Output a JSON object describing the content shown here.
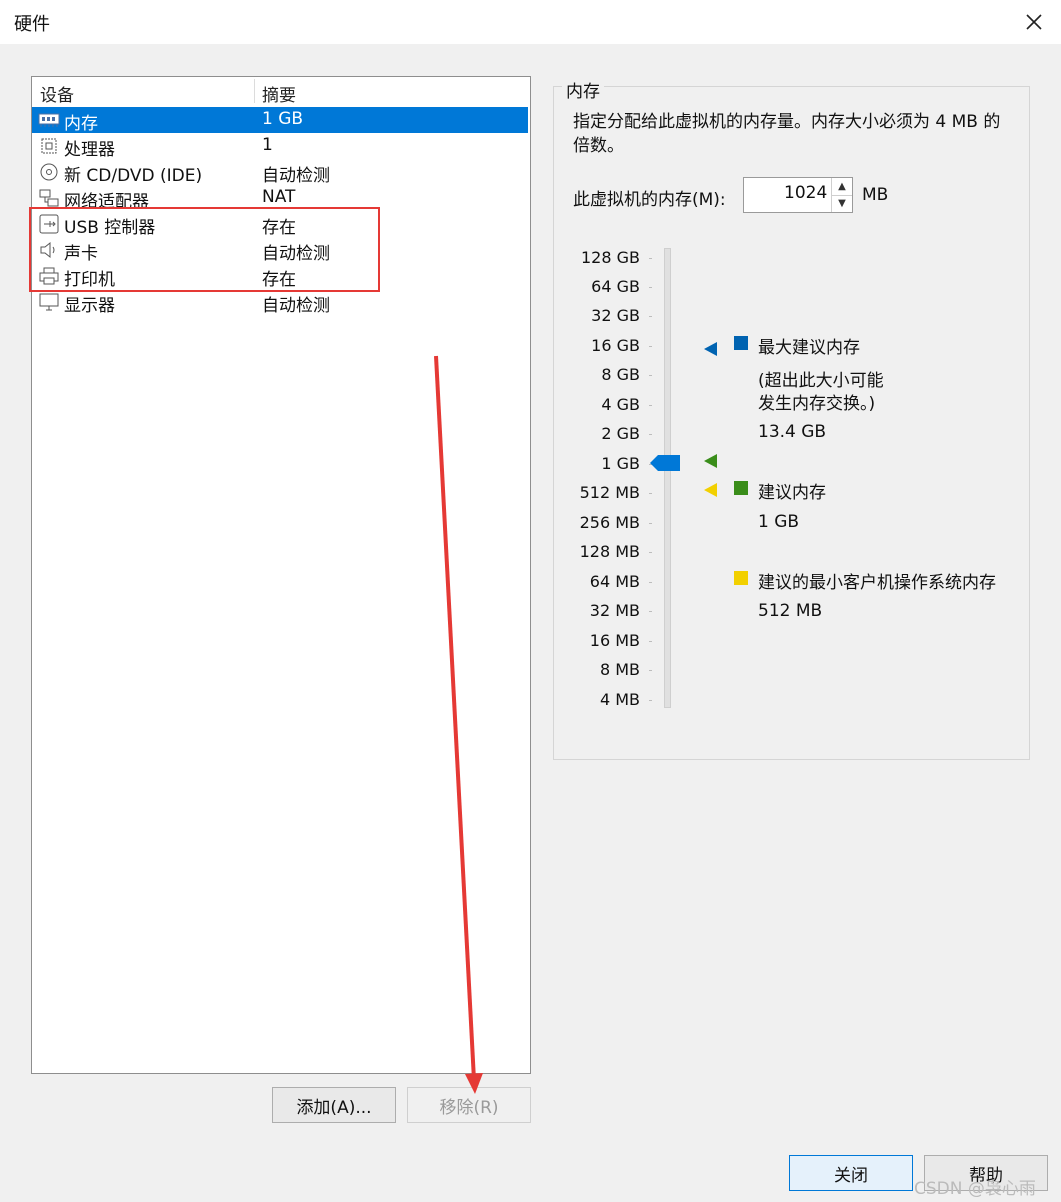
{
  "window": {
    "title": "硬件"
  },
  "device_list": {
    "columns": [
      "设备",
      "摘要"
    ],
    "items": [
      {
        "name": "内存",
        "summary": "1 GB",
        "icon": "memory-icon",
        "selected": true
      },
      {
        "name": "处理器",
        "summary": "1",
        "icon": "processor-icon",
        "selected": false
      },
      {
        "name": "新 CD/DVD (IDE)",
        "summary": "自动检测",
        "icon": "cd-dvd-icon",
        "selected": false
      },
      {
        "name": "网络适配器",
        "summary": "NAT",
        "icon": "network-adapter-icon",
        "selected": false
      },
      {
        "name": "USB 控制器",
        "summary": "存在",
        "icon": "usb-icon",
        "selected": false
      },
      {
        "name": "声卡",
        "summary": "自动检测",
        "icon": "speaker-icon",
        "selected": false
      },
      {
        "name": "打印机",
        "summary": "存在",
        "icon": "printer-icon",
        "selected": false
      },
      {
        "name": "显示器",
        "summary": "自动检测",
        "icon": "monitor-icon",
        "selected": false
      }
    ]
  },
  "buttons": {
    "add": "添加(A)...",
    "remove": "移除(R)",
    "close": "关闭",
    "help": "帮助"
  },
  "memory": {
    "group_title": "内存",
    "description": "指定分配给此虚拟机的内存量。内存大小必须为 4 MB 的倍数。",
    "label": "此虚拟机的内存(M):",
    "value": "1024",
    "unit": "MB",
    "scale_ticks": [
      "128 GB",
      "64 GB",
      "32 GB",
      "16 GB",
      "8 GB",
      "4 GB",
      "2 GB",
      "1 GB",
      "512 MB",
      "256 MB",
      "128 MB",
      "64 MB",
      "32 MB",
      "16 MB",
      "8 MB",
      "4 MB"
    ],
    "current_tick": "1 GB",
    "legend": {
      "max": {
        "title": "最大建议内存",
        "note_line1": "(超出此大小可能",
        "note_line2": "发生内存交换。)",
        "value": "13.4 GB",
        "color": "#0063b1"
      },
      "recommended": {
        "title": "建议内存",
        "value": "1 GB",
        "color": "#3a8d1a"
      },
      "min": {
        "title": "建议的最小客户机操作系统内存",
        "value": "512 MB",
        "color": "#f2d000"
      }
    },
    "selected_color": "#0078d7"
  },
  "watermark": "CSDN @袅心雨"
}
